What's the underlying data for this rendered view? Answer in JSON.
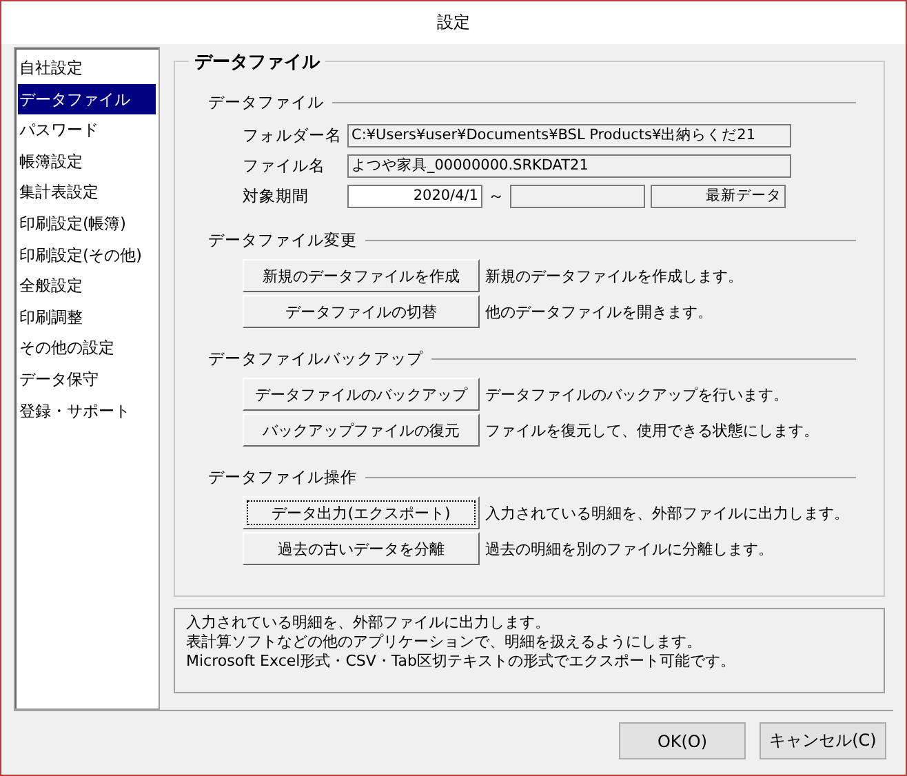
{
  "window": {
    "title": "設定"
  },
  "sidebar": {
    "items": [
      {
        "label": "自社設定",
        "selected": false
      },
      {
        "label": "データファイル",
        "selected": true
      },
      {
        "label": "パスワード",
        "selected": false
      },
      {
        "label": "帳簿設定",
        "selected": false
      },
      {
        "label": "集計表設定",
        "selected": false
      },
      {
        "label": "印刷設定(帳簿)",
        "selected": false
      },
      {
        "label": "印刷設定(その他)",
        "selected": false
      },
      {
        "label": "全般設定",
        "selected": false
      },
      {
        "label": "印刷調整",
        "selected": false
      },
      {
        "label": "その他の設定",
        "selected": false
      },
      {
        "label": "データ保守",
        "selected": false
      },
      {
        "label": "登録・サポート",
        "selected": false
      }
    ]
  },
  "panel": {
    "title": "データファイル",
    "sections": [
      {
        "title": "データファイル",
        "kind": "fields",
        "fields": [
          {
            "label": "フォルダー名",
            "boxes": [
              {
                "value": "C:¥Users¥user¥Documents¥BSL Products¥出納らくだ21",
                "editable": false
              }
            ]
          },
          {
            "label": "ファイル名",
            "boxes": [
              {
                "value": "よつや家具_00000000.SRKDAT21",
                "editable": false
              }
            ]
          },
          {
            "label": "対象期間",
            "separator": "～",
            "boxes": [
              {
                "value": "2020/4/1",
                "editable": true
              },
              {
                "editable": false
              },
              {
                "value": "最新データ",
                "editable": false
              }
            ]
          }
        ]
      },
      {
        "title": "データファイル変更",
        "kind": "buttons",
        "actions": [
          {
            "button": "新規のデータファイルを作成",
            "description": "新規のデータファイルを作成します。",
            "focused": false
          },
          {
            "button": "データファイルの切替",
            "description": "他のデータファイルを開きます。",
            "focused": false
          }
        ]
      },
      {
        "title": "データファイルバックアップ",
        "kind": "buttons",
        "actions": [
          {
            "button": "データファイルのバックアップ",
            "description": "データファイルのバックアップを行います。",
            "focused": false
          },
          {
            "button": "バックアップファイルの復元",
            "description": "ファイルを復元して、使用できる状態にします。",
            "focused": false
          }
        ]
      },
      {
        "title": "データファイル操作",
        "kind": "buttons",
        "actions": [
          {
            "button": "データ出力(エクスポート)",
            "description": "入力されている明細を、外部ファイルに出力します。",
            "focused": true
          },
          {
            "button": "過去の古いデータを分離",
            "description": "過去の明細を別のファイルに分離します。",
            "focused": false
          }
        ]
      }
    ]
  },
  "help_text": [
    "入力されている明細を、外部ファイルに出力します。",
    "表計算ソフトなどの他のアプリケーションで、明細を扱えるようにします。",
    "Microsoft Excel形式・CSV・Tab区切テキストの形式でエクスポート可能です。"
  ],
  "buttons": [
    "OK(O)",
    "キャンセル(C)"
  ]
}
